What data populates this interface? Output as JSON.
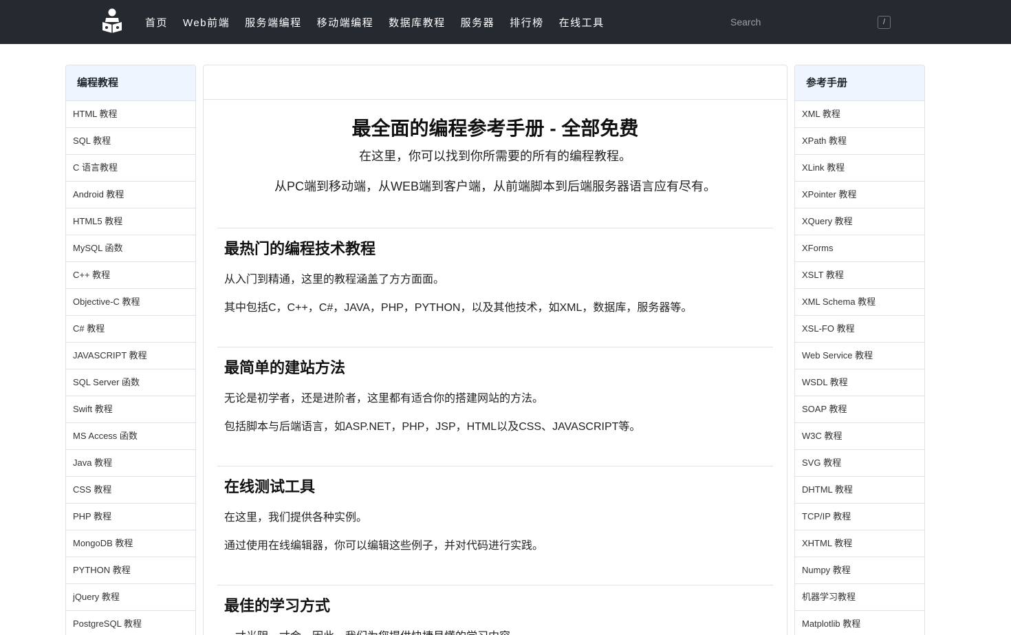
{
  "nav": {
    "items": [
      "首页",
      "Web前端",
      "服务端编程",
      "移动端编程",
      "数据库教程",
      "服务器",
      "排行榜",
      "在线工具"
    ],
    "search_placeholder": "Search",
    "search_shortcut": "/"
  },
  "left_sidebar": {
    "title": "编程教程",
    "items": [
      "HTML 教程",
      "SQL 教程",
      "C 语言教程",
      "Android 教程",
      "HTML5 教程",
      "MySQL 函数",
      "C++ 教程",
      "Objective-C 教程",
      "C# 教程",
      "JAVASCRIPT 教程",
      "SQL Server 函数",
      "Swift 教程",
      "MS Access 函数",
      "Java 教程",
      "CSS 教程",
      "PHP 教程",
      "MongoDB 教程",
      "PYTHON 教程",
      "jQuery 教程",
      "PostgreSQL 教程"
    ]
  },
  "right_sidebar": {
    "title": "参考手册",
    "items": [
      "XML 教程",
      "XPath 教程",
      "XLink 教程",
      "XPointer 教程",
      "XQuery 教程",
      "XForms",
      "XSLT 教程",
      "XML Schema 教程",
      "XSL-FO 教程",
      "Web Service 教程",
      "WSDL 教程",
      "SOAP 教程",
      "W3C 教程",
      "SVG 教程",
      "DHTML 教程",
      "TCP/IP 教程",
      "XHTML 教程",
      "Numpy 教程",
      "机器学习教程",
      "Matplotlib 教程"
    ]
  },
  "main": {
    "title": "最全面的编程参考手册 - 全部免费",
    "subtitle1": "在这里，你可以找到你所需要的所有的编程教程。",
    "subtitle2": "从PC端到移动端，从WEB端到客户端，从前端脚本到后端服务器语言应有尽有。",
    "sections": [
      {
        "heading": "最热门的编程技术教程",
        "p1": "从入门到精通，这里的教程涵盖了方方面面。",
        "p2": "其中包括C，C++，C#，JAVA，PHP，PYTHON，以及其他技术，如XML，数据库，服务器等。"
      },
      {
        "heading": "最简单的建站方法",
        "p1": "无论是初学者，还是进阶者，这里都有适合你的搭建网站的方法。",
        "p2": "包括脚本与后端语言，如ASP.NET，PHP，JSP，HTML以及CSS、JAVASCRIPT等。"
      },
      {
        "heading": "在线测试工具",
        "p1": "在这里，我们提供各种实例。",
        "p2": "通过使用在线编辑器，你可以编辑这些例子，并对代码进行实践。"
      },
      {
        "heading": "最佳的学习方式",
        "p1": "一寸光阴一寸金，因此，我们为您提供快捷易懂的学习内容。",
        "p2": ""
      }
    ]
  }
}
